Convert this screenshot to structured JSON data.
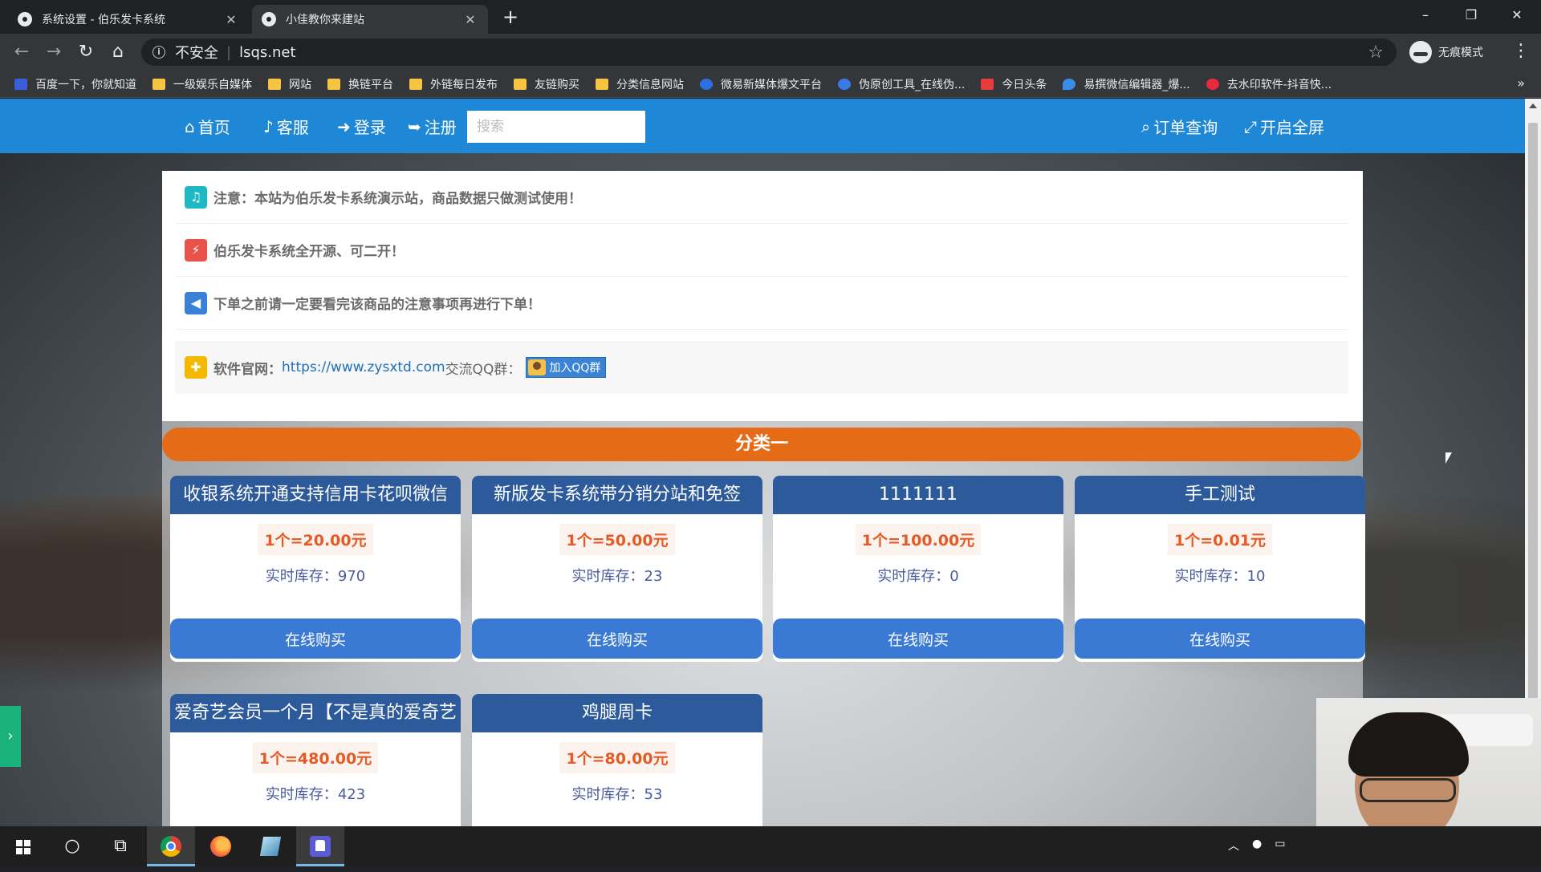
{
  "browser": {
    "tabs": [
      {
        "title": "系统设置 - 伯乐发卡系统",
        "active": false
      },
      {
        "title": "小佳教你来建站",
        "active": true
      }
    ],
    "new_tab": "+",
    "address": {
      "security_label": "不安全",
      "url": "lsqs.net"
    },
    "incognito_label": "无痕模式",
    "window_controls": {
      "minimize": "–",
      "restore": "❐",
      "close": "✕"
    },
    "nav": {
      "back": "←",
      "forward": "→",
      "reload": "↻",
      "home": "⌂"
    },
    "bookmarks": [
      {
        "label": "百度一下，你就知道",
        "icon": "baidu-icon",
        "color": "#3b5dd8"
      },
      {
        "label": "一级娱乐自媒体",
        "icon": "folder-icon"
      },
      {
        "label": "网站",
        "icon": "folder-icon"
      },
      {
        "label": "换链平台",
        "icon": "folder-icon"
      },
      {
        "label": "外链每日发布",
        "icon": "folder-icon"
      },
      {
        "label": "友链购买",
        "icon": "folder-icon"
      },
      {
        "label": "分类信息网站",
        "icon": "folder-icon"
      },
      {
        "label": "微易新媒体爆文平台",
        "icon": "weiyi-icon",
        "color": "#2b6fe0"
      },
      {
        "label": "伪原创工具_在线伪...",
        "icon": "fake-original-icon",
        "color": "#3b7be8"
      },
      {
        "label": "今日头条",
        "icon": "toutiao-icon",
        "color": "#e83b3b"
      },
      {
        "label": "易撰微信编辑器_爆...",
        "icon": "yizhuan-icon",
        "color": "#3b8be8"
      },
      {
        "label": "去水印软件-抖音快...",
        "icon": "watermark-icon",
        "color": "#e82a3b"
      }
    ],
    "bookmarks_more": "»"
  },
  "site": {
    "nav": {
      "home": "首页",
      "service": "客服",
      "login": "登录",
      "register": "注册",
      "search_placeholder": "搜索",
      "order_query": "订单查询",
      "fullscreen": "开启全屏"
    },
    "notices": {
      "notice1": "注意：本站为伯乐发卡系统演示站，商品数据只做测试使用！",
      "notice2": "伯乐发卡系统全开源、可二开！",
      "notice3": "下单之前请一定要看完该商品的注意事项再进行下单！",
      "notice4_prefix": "软件官网：",
      "notice4_link": "https://www.zysxtd.com",
      "notice4_mid": " 交流QQ群：",
      "qq_button": "加入QQ群"
    },
    "category": {
      "title": "分类一"
    },
    "buy_label": "在线购买",
    "products": [
      {
        "title": "收银系统开通支持信用卡花呗微信",
        "price": "1个=20.00元",
        "stock_label": "实时库存：",
        "stock": "970"
      },
      {
        "title": "新版发卡系统带分销分站和免签",
        "price": "1个=50.00元",
        "stock_label": "实时库存：",
        "stock": "23"
      },
      {
        "title": "1111111",
        "price": "1个=100.00元",
        "stock_label": "实时库存：",
        "stock": "0"
      },
      {
        "title": "手工测试",
        "price": "1个=0.01元",
        "stock_label": "实时库存：",
        "stock": "10"
      },
      {
        "title": "爱奇艺会员一个月【不是真的爱奇艺",
        "price": "1个=480.00元",
        "stock_label": "实时库存：",
        "stock": "423"
      },
      {
        "title": "鸡腿周卡",
        "price": "1个=80.00元",
        "stock_label": "实时库存：",
        "stock": "53"
      }
    ],
    "side_toggle": "›"
  },
  "colors": {
    "nav_blue": "#1e88d6",
    "category_orange": "#e56b17",
    "card_header": "#2c5a9a",
    "buy_button": "#3a7ad4",
    "price_red": "#e55a25"
  }
}
